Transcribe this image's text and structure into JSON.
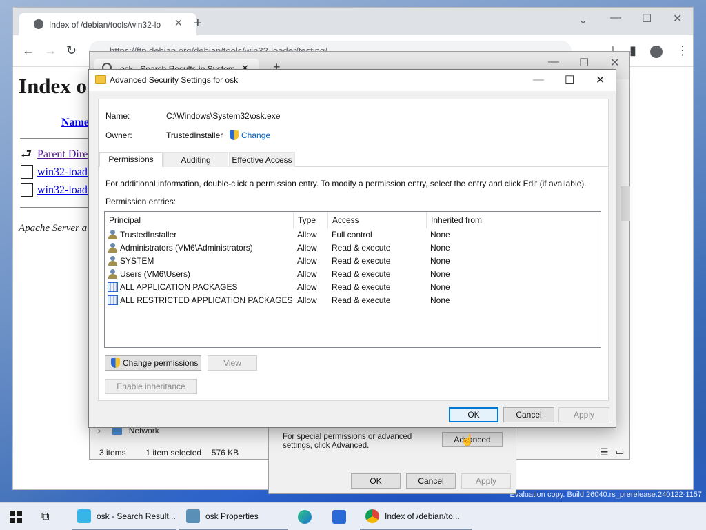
{
  "browser": {
    "tab_title": "Index of /debian/tools/win32-lo",
    "new_tab": "+",
    "url": "https://ftp.debian.org/debian/tools/win32-loader/testing/",
    "page": {
      "heading": "Index o",
      "name_col": "Name",
      "links": [
        "Parent Dire",
        "win32-loade",
        "win32-loade"
      ],
      "footer": "Apache Server a"
    }
  },
  "explorer": {
    "tab_title": "osk - Search Results in System",
    "nav_network": "Network",
    "status_items": "3 items",
    "status_selected": "1 item selected",
    "status_size": "576 KB"
  },
  "props": {
    "text": "For special permissions or advanced settings, click Advanced.",
    "advanced_label": "Advanced",
    "ok_label": "OK",
    "cancel_label": "Cancel",
    "apply_label": "Apply"
  },
  "adv": {
    "title": "Advanced Security Settings for osk",
    "name_label": "Name:",
    "name_value": "C:\\Windows\\System32\\osk.exe",
    "owner_label": "Owner:",
    "owner_value": "TrustedInstaller",
    "change_label": "Change",
    "tabs": [
      "Permissions",
      "Auditing",
      "Effective Access"
    ],
    "info_text": "For additional information, double-click a permission entry. To modify a permission entry, select the entry and click Edit (if available).",
    "entries_label": "Permission entries:",
    "columns": [
      "Principal",
      "Type",
      "Access",
      "Inherited from"
    ],
    "rows": [
      {
        "principal": "TrustedInstaller",
        "type": "Allow",
        "access": "Full control",
        "inherited": "None",
        "icon": "user-group-icon"
      },
      {
        "principal": "Administrators (VM6\\Administrators)",
        "type": "Allow",
        "access": "Read & execute",
        "inherited": "None",
        "icon": "user-group-icon"
      },
      {
        "principal": "SYSTEM",
        "type": "Allow",
        "access": "Read & execute",
        "inherited": "None",
        "icon": "user-group-icon"
      },
      {
        "principal": "Users (VM6\\Users)",
        "type": "Allow",
        "access": "Read & execute",
        "inherited": "None",
        "icon": "user-group-icon"
      },
      {
        "principal": "ALL APPLICATION PACKAGES",
        "type": "Allow",
        "access": "Read & execute",
        "inherited": "None",
        "icon": "app-package-icon"
      },
      {
        "principal": "ALL RESTRICTED APPLICATION PACKAGES",
        "type": "Allow",
        "access": "Read & execute",
        "inherited": "None",
        "icon": "app-package-icon"
      }
    ],
    "change_permissions_label": "Change permissions",
    "view_label": "View",
    "enable_inheritance_label": "Enable inheritance",
    "ok_label": "OK",
    "cancel_label": "Cancel",
    "apply_label": "Apply"
  },
  "desktop": {
    "eval_text": "Evaluation copy. Build 26040.rs_prerelease.240122-1157"
  },
  "taskbar": {
    "items": [
      {
        "label": "osk - Search Result...",
        "icon": "file-explorer-icon"
      },
      {
        "label": "osk Properties",
        "icon": "properties-icon"
      },
      {
        "label": "Index of /debian/to...",
        "icon": "chrome-icon"
      }
    ]
  }
}
